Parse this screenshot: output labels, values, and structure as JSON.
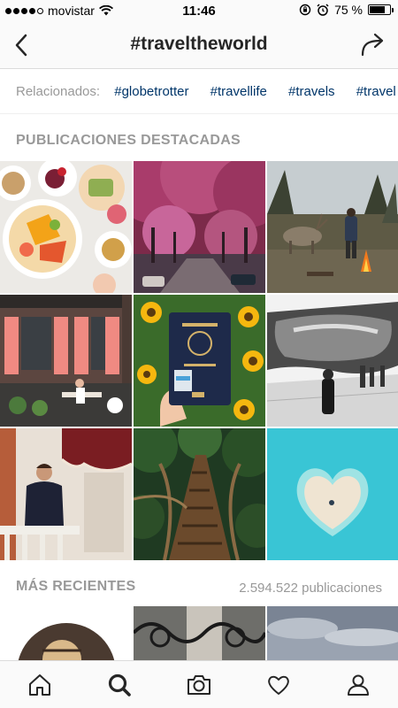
{
  "status": {
    "carrier": "movistar",
    "time": "11:46",
    "battery": "75 %",
    "battery_level": 0.75
  },
  "nav": {
    "title": "#traveltheworld"
  },
  "related": {
    "label": "Relacionados:",
    "tags": [
      "#globetrotter",
      "#travellife",
      "#travels",
      "#travel"
    ]
  },
  "featured": {
    "header": "PUBLICACIONES DESTACADAS"
  },
  "recent": {
    "header": "MÁS RECIENTES",
    "count": "2.594.522 publicaciones"
  },
  "tiles_featured": [
    "breakfast-photo",
    "pink-tree-street-photo",
    "reindeer-campfire-photo",
    "pink-shutters-building-photo",
    "passport-photo",
    "cloud-gate-photo",
    "man-balcony-photo",
    "jungle-bridge-photo",
    "heart-island-photo"
  ],
  "tiles_recent": [
    "recent-photo-1",
    "recent-photo-2",
    "recent-photo-3"
  ],
  "colors": {
    "link": "#003569",
    "muted": "#999999",
    "border": "#dbdbdb"
  }
}
